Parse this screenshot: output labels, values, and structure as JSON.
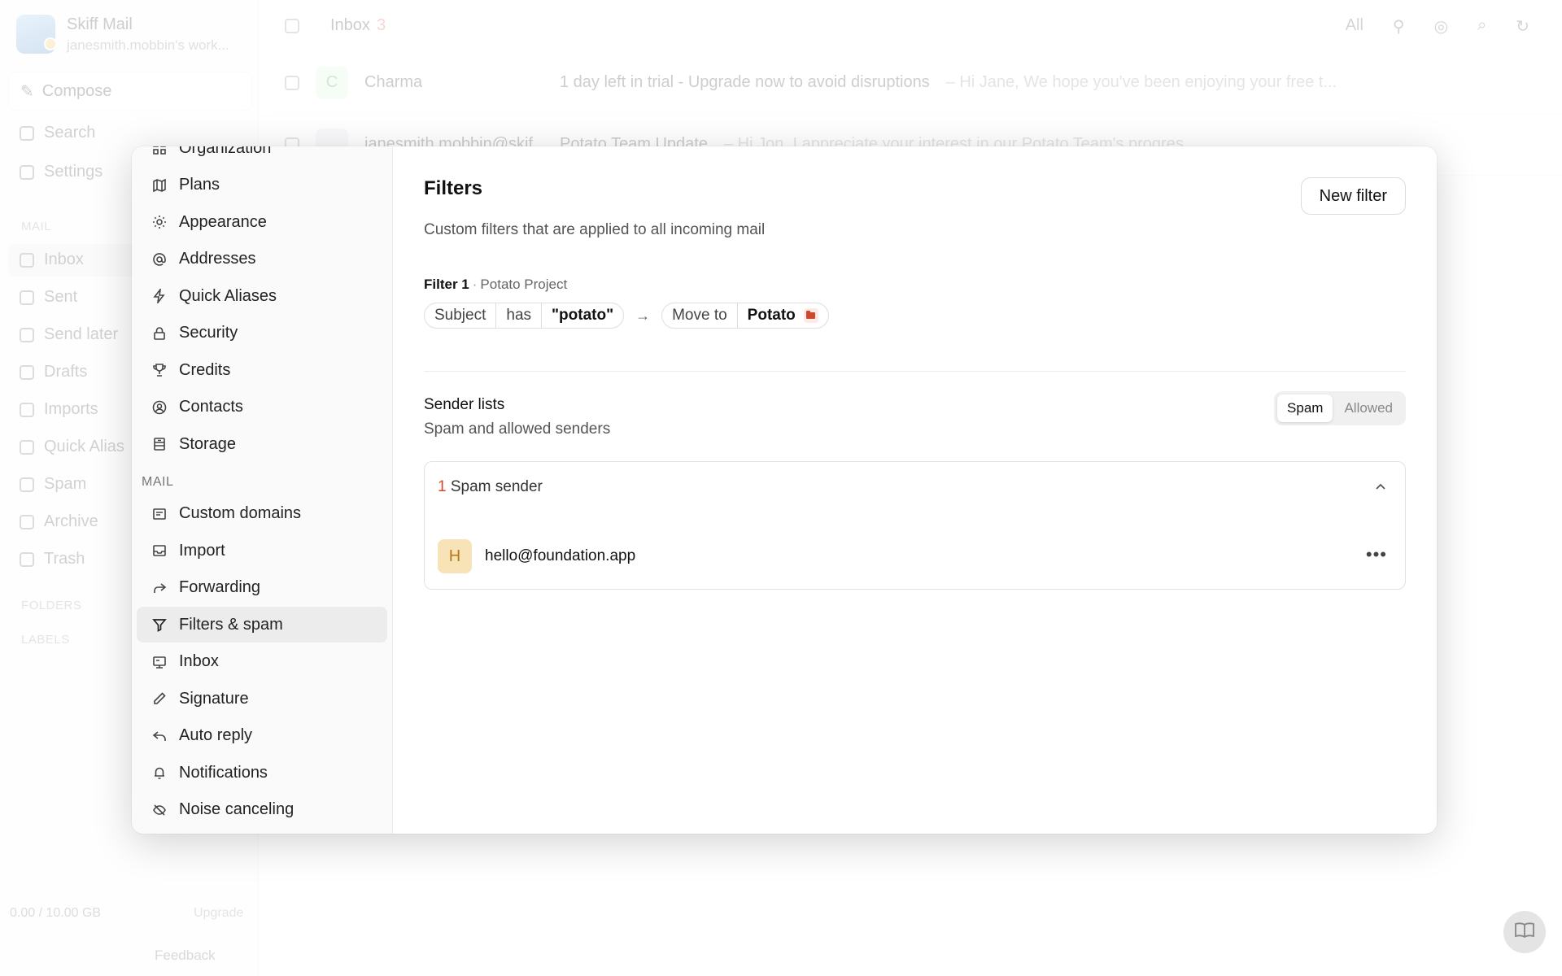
{
  "app": {
    "name": "Skiff Mail",
    "account": "janesmith.mobbin's work...",
    "compose": "Compose",
    "search": "Search",
    "settings": "Settings",
    "mail_head": "MAIL",
    "folders": [
      "Inbox",
      "Sent",
      "Send later",
      "Drafts",
      "Imports",
      "Quick Alias",
      "Spam",
      "Archive",
      "Trash"
    ],
    "folders_head": "FOLDERS",
    "labels_head": "LABELS",
    "storage": "0.00 / 10.00 GB",
    "upgrade": "Upgrade",
    "feedback": "Feedback",
    "inbox_title": "Inbox",
    "inbox_count": "3",
    "filter_all": "All",
    "rows": [
      {
        "sender": "Charma",
        "subject": "1 day left in trial - Upgrade now to avoid disruptions",
        "preview": "– Hi Jane, We hope you've been enjoying your free t..."
      },
      {
        "sender": "janesmith.mobbin@skif",
        "subject": "Potato Team Update",
        "preview": "– Hi Jon, I appreciate your interest in our Potato Team's progres..."
      }
    ]
  },
  "settings_nav": {
    "items_top": [
      {
        "label": "Organization",
        "icon": "organization-icon"
      },
      {
        "label": "Plans",
        "icon": "plans-icon"
      },
      {
        "label": "Appearance",
        "icon": "appearance-icon"
      },
      {
        "label": "Addresses",
        "icon": "at-icon"
      },
      {
        "label": "Quick Aliases",
        "icon": "lightning-icon"
      },
      {
        "label": "Security",
        "icon": "lock-icon"
      },
      {
        "label": "Credits",
        "icon": "trophy-icon"
      },
      {
        "label": "Contacts",
        "icon": "contact-icon"
      },
      {
        "label": "Storage",
        "icon": "storage-icon"
      }
    ],
    "mail_header": "MAIL",
    "items_mail": [
      {
        "label": "Custom domains",
        "icon": "domain-icon"
      },
      {
        "label": "Import",
        "icon": "import-icon"
      },
      {
        "label": "Forwarding",
        "icon": "forward-icon"
      },
      {
        "label": "Filters & spam",
        "icon": "filter-icon"
      },
      {
        "label": "Inbox",
        "icon": "inbox-icon"
      },
      {
        "label": "Signature",
        "icon": "pen-icon"
      },
      {
        "label": "Auto reply",
        "icon": "reply-icon"
      },
      {
        "label": "Notifications",
        "icon": "bell-icon"
      },
      {
        "label": "Noise canceling",
        "icon": "noise-icon"
      }
    ]
  },
  "filters": {
    "title": "Filters",
    "new_filter": "New filter",
    "description": "Custom filters that are applied to all incoming mail",
    "filter_label": "Filter 1",
    "filter_name": "Potato Project",
    "condition_field": "Subject",
    "condition_op": "has",
    "condition_value": "\"potato\"",
    "action": "Move to",
    "action_target": "Potato"
  },
  "sender_lists": {
    "title": "Sender lists",
    "subtitle": "Spam and allowed senders",
    "tab_spam": "Spam",
    "tab_allowed": "Allowed",
    "count": "1",
    "count_label": "Spam sender",
    "sender_initial": "H",
    "sender_email": "hello@foundation.app"
  },
  "colors": {
    "accent_red": "#d9472b",
    "folder": "#cc4a2c",
    "avatar_bg": "#f8e3b8"
  }
}
